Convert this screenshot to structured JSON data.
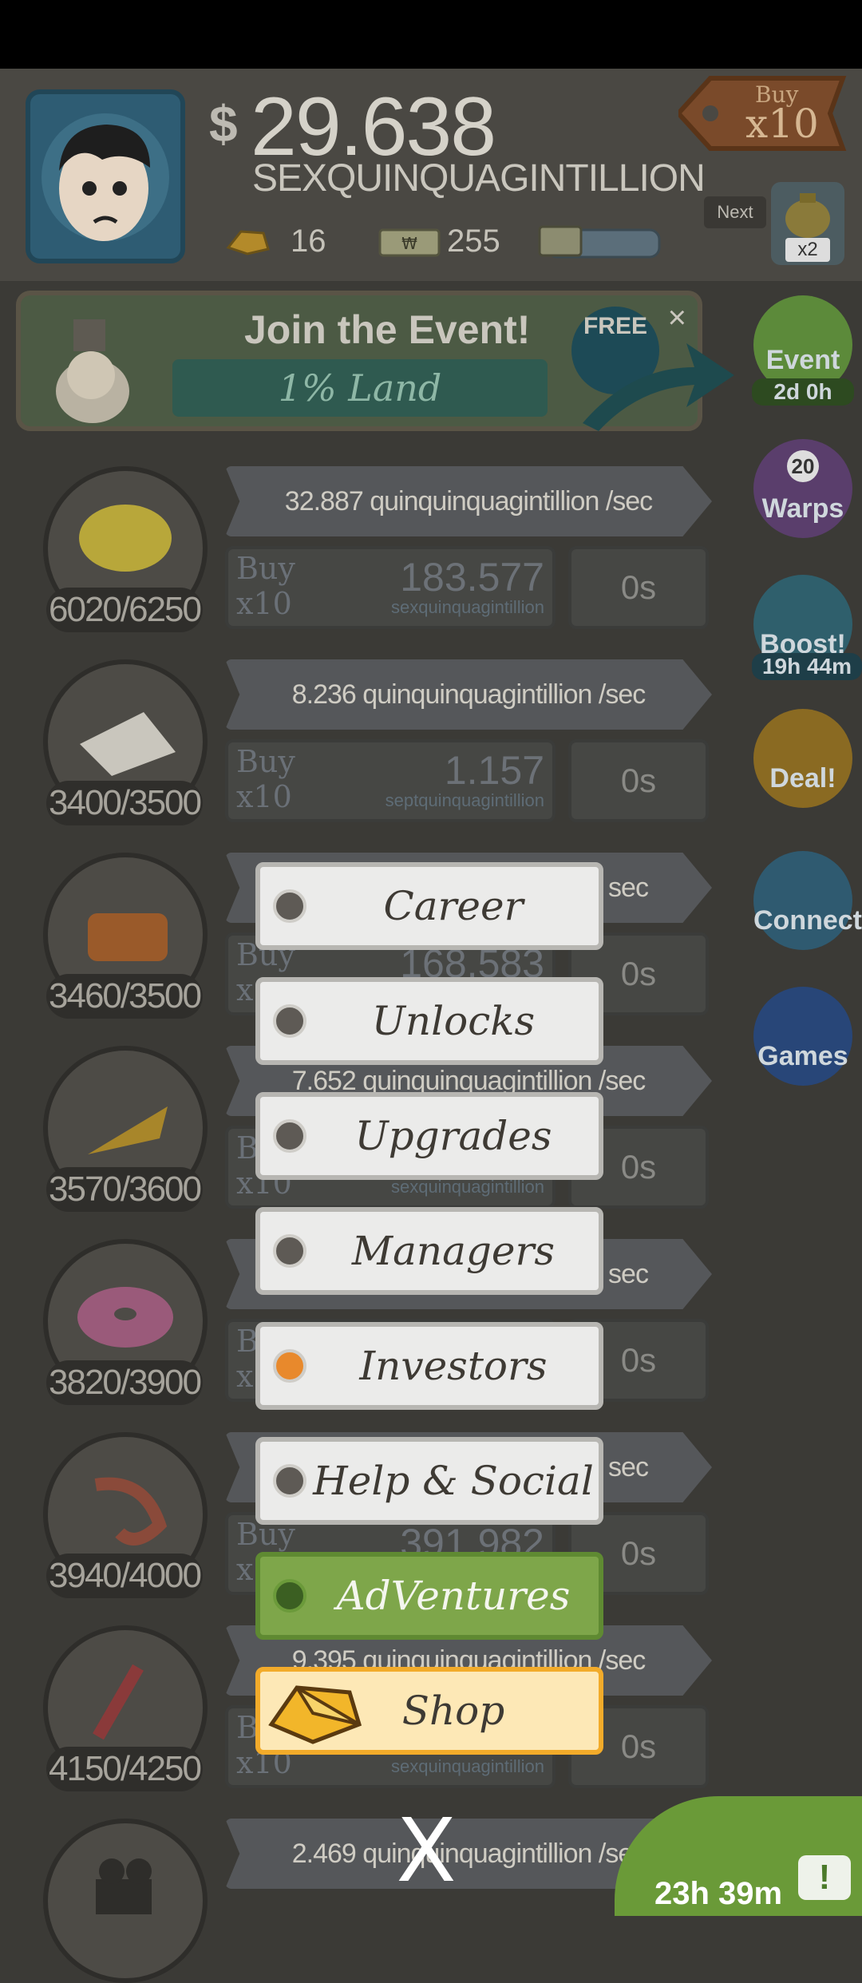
{
  "header": {
    "currency_symbol": "$",
    "money_value": "29.638",
    "money_unit": "SEXQUINQUAGINTILLION",
    "gold_count": "16",
    "megabucks_count": "255",
    "buy_label": "Buy",
    "buy_mult": "x10",
    "next_label": "Next",
    "next_mult": "x2"
  },
  "event_banner": {
    "title": "Join the Event!",
    "progress": "1% Land",
    "free_label": "FREE",
    "close": "×"
  },
  "side_buttons": [
    {
      "label": "Event",
      "sub": "2d 0h",
      "color": "#5c8a3a"
    },
    {
      "label": "Warps",
      "badge": "20",
      "color": "#6a4a7c"
    },
    {
      "label": "Boost!",
      "sub": "19h 44m",
      "color": "#2f6b7c"
    },
    {
      "label": "Deal!",
      "color": "#8a6a22"
    },
    {
      "label": "Connect",
      "color": "#2f5f7c"
    },
    {
      "label": "Games",
      "color": "#2a4a7c"
    }
  ],
  "businesses": [
    {
      "icon": "lemon",
      "count": "6020/6250",
      "rate": "32.887 quinquinquagintillion /sec",
      "buy": "Buy",
      "mult": "x10",
      "cost": "183.577",
      "cost_unit": "sexquinquagintillion",
      "time": "0s"
    },
    {
      "icon": "newspaper",
      "count": "3400/3500",
      "rate": "8.236 quinquinquagintillion /sec",
      "buy": "Buy",
      "mult": "x10",
      "cost": "1.157",
      "cost_unit": "septquinquagintillion",
      "time": "0s"
    },
    {
      "icon": "car",
      "count": "3460/3500",
      "rate": "sec",
      "buy": "Buy",
      "mult": "x",
      "cost": "168.583",
      "cost_unit": "",
      "time": "0s"
    },
    {
      "icon": "pizza",
      "count": "3570/3600",
      "rate": "7.652 quinquinquagintillion /sec",
      "buy": "B",
      "mult": "x10",
      "cost": "",
      "cost_unit": "sexquinquagintillion",
      "time": "0s"
    },
    {
      "icon": "donut",
      "count": "3820/3900",
      "rate": "sec",
      "buy": "B",
      "mult": "x",
      "cost": "",
      "cost_unit": "",
      "time": "0s"
    },
    {
      "icon": "shrimp",
      "count": "3940/4000",
      "rate": "sec",
      "buy": "Buy",
      "mult": "x",
      "cost": "391.982",
      "cost_unit": "",
      "time": "0s"
    },
    {
      "icon": "hockey",
      "count": "4150/4250",
      "rate": "9.395 quinquinquagintillion /sec",
      "buy": "B",
      "mult": "x10",
      "cost": "",
      "cost_unit": "sexquinquagintillion",
      "time": "0s"
    },
    {
      "icon": "movie",
      "count": "",
      "rate": "2.469 quinquinquagintillion /sec",
      "buy": "",
      "mult": "",
      "cost": "",
      "cost_unit": "",
      "time": ""
    }
  ],
  "menu": {
    "items": [
      "Career",
      "Unlocks",
      "Upgrades",
      "Managers",
      "Investors",
      "Help & Social",
      "AdVentures",
      "Shop"
    ],
    "close": "X"
  },
  "tv_offer": {
    "timer": "23h 39m",
    "icon_text": "!"
  },
  "colors": {
    "active_dot": "#e8892c",
    "adventures": "#7ea64a",
    "shop_border": "#f2ab2a"
  }
}
